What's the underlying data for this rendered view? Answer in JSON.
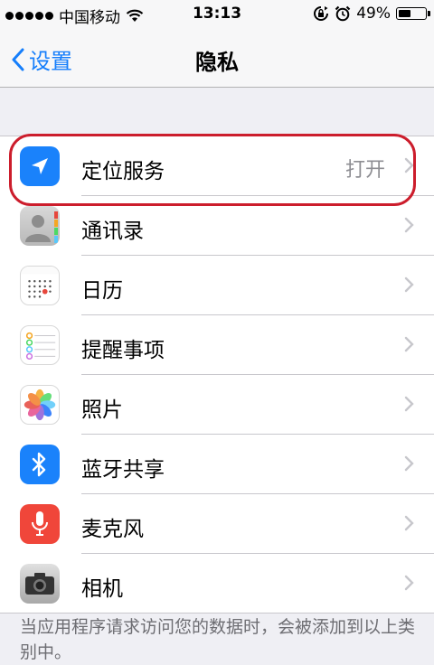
{
  "status_bar": {
    "carrier": "中国移动",
    "time": "13:13",
    "battery_percent": "49%",
    "battery_level": 0.49,
    "icons": [
      "signal-dots-icon",
      "wifi-icon",
      "rotation-lock-icon",
      "alarm-icon",
      "battery-icon"
    ]
  },
  "nav": {
    "back_label": "设置",
    "title": "隐私"
  },
  "items": [
    {
      "label": "定位服务",
      "value": "打开",
      "icon": "location-arrow-icon"
    },
    {
      "label": "通讯录",
      "icon": "contacts-icon"
    },
    {
      "label": "日历",
      "icon": "calendar-icon"
    },
    {
      "label": "提醒事项",
      "icon": "reminders-icon"
    },
    {
      "label": "照片",
      "icon": "photos-icon"
    },
    {
      "label": "蓝牙共享",
      "icon": "bluetooth-icon"
    },
    {
      "label": "麦克风",
      "icon": "microphone-icon"
    },
    {
      "label": "相机",
      "icon": "camera-icon"
    }
  ],
  "footer_note": "当应用程序请求访问您的数据时，会被添加到以上类别中。",
  "colors": {
    "accent": "#157efb",
    "highlight": "#cc1d2c",
    "background": "#efeff4"
  }
}
